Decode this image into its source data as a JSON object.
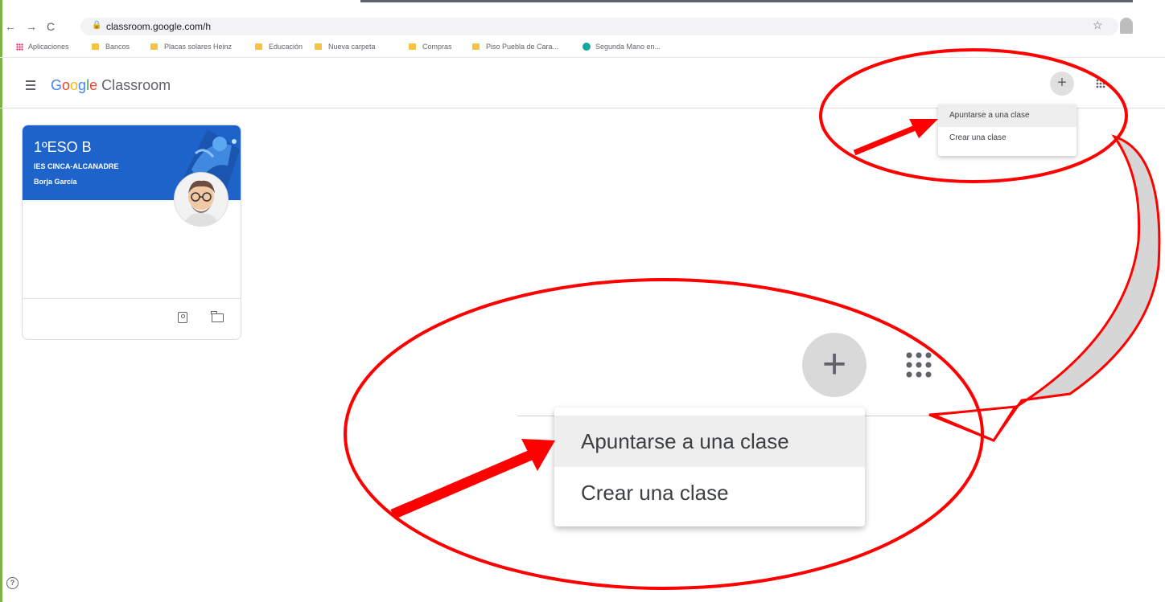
{
  "browser": {
    "nav": {
      "back": "←",
      "forward": "→",
      "reload": "C"
    },
    "url": "classroom.google.com/h",
    "bookmarks": [
      {
        "label": "Aplicaciones",
        "icon": "apps-grid-icon"
      },
      {
        "label": "Bancos",
        "icon": "folder-icon"
      },
      {
        "label": "Placas solares Heinz",
        "icon": "folder-icon"
      },
      {
        "label": "Educación",
        "icon": "folder-icon"
      },
      {
        "label": "Nueva carpeta",
        "icon": "folder-icon"
      },
      {
        "label": "Compras",
        "icon": "folder-icon"
      },
      {
        "label": "Piso Puebla de Cara...",
        "icon": "folder-icon"
      },
      {
        "label": "Segunda Mano en...",
        "icon": "globe-icon"
      }
    ]
  },
  "header": {
    "brand_google": "Google",
    "brand_product": "Classroom",
    "plus_symbol": "+"
  },
  "menu": {
    "join": "Apuntarse a una clase",
    "create": "Crear una clase"
  },
  "class_card": {
    "title": "1ºESO B",
    "section": "IES CINCA-ALCANADRE",
    "teacher": "Borja García",
    "banner_color": "#1e63c9"
  },
  "help_symbol": "?",
  "colors": {
    "annotation_red": "#ff0000",
    "accent_green": "#7cb342"
  }
}
